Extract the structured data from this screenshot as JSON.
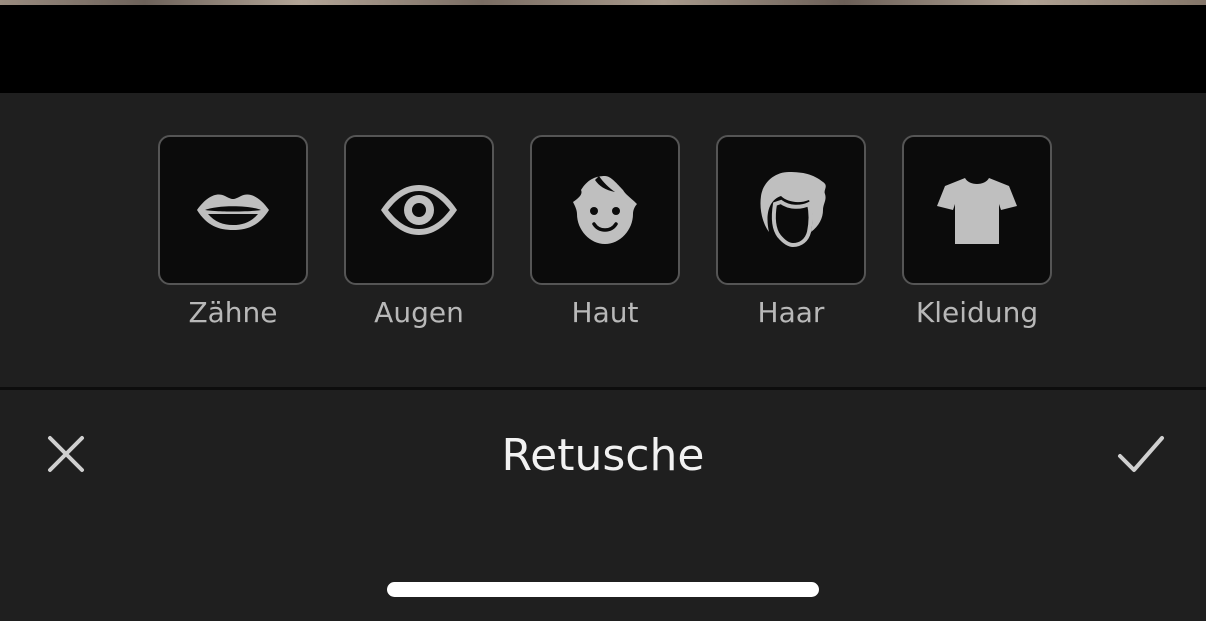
{
  "header": {
    "title": "Retusche"
  },
  "tools": [
    {
      "label": "Zähne",
      "icon": "lips-icon"
    },
    {
      "label": "Augen",
      "icon": "eye-icon"
    },
    {
      "label": "Haut",
      "icon": "face-icon"
    },
    {
      "label": "Haar",
      "icon": "hair-icon"
    },
    {
      "label": "Kleidung",
      "icon": "shirt-icon"
    }
  ],
  "actions": {
    "close_icon": "close-icon",
    "confirm_icon": "checkmark-icon"
  },
  "colors": {
    "background": "#1f1f1f",
    "tool_box_bg": "#0b0b0b",
    "tool_border": "#555555",
    "icon": "#bfbfbf",
    "label": "#b8b8b8",
    "title": "#f2f2f2"
  }
}
